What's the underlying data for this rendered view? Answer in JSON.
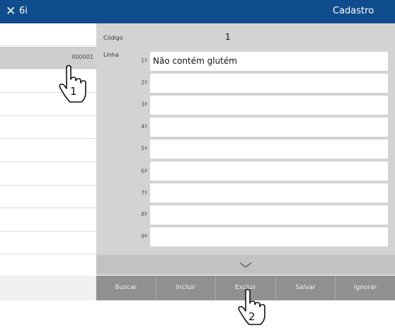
{
  "titlebar": {
    "close_icon": "close-icon",
    "app_label": "6i",
    "title": "Cadastro"
  },
  "list": {
    "rows": [
      {
        "code": ""
      },
      {
        "code": "000001"
      },
      {
        "code": ""
      },
      {
        "code": ""
      },
      {
        "code": ""
      },
      {
        "code": ""
      },
      {
        "code": ""
      },
      {
        "code": ""
      },
      {
        "code": ""
      },
      {
        "code": ""
      },
      {
        "code": ""
      },
      {
        "code": ""
      }
    ]
  },
  "form": {
    "codigo_label": "Código",
    "codigo_value": "1",
    "linha_label": "Linha",
    "lines": [
      {
        "ordinal": "1ª",
        "value": "Não contém glutém"
      },
      {
        "ordinal": "2ª",
        "value": ""
      },
      {
        "ordinal": "3ª",
        "value": ""
      },
      {
        "ordinal": "4ª",
        "value": ""
      },
      {
        "ordinal": "5ª",
        "value": ""
      },
      {
        "ordinal": "6ª",
        "value": ""
      },
      {
        "ordinal": "7ª",
        "value": ""
      },
      {
        "ordinal": "8ª",
        "value": ""
      },
      {
        "ordinal": "9ª",
        "value": ""
      }
    ]
  },
  "expander_icon": "chevron-down-icon",
  "toolbar": {
    "buttons": [
      "Buscar",
      "Incluir",
      "Excluir",
      "Salvar",
      "Ignorar"
    ]
  },
  "callouts": [
    {
      "icon": "hand-pointer-icon",
      "number": "1"
    },
    {
      "icon": "hand-pointer-icon",
      "number": "2"
    }
  ],
  "colors": {
    "titlebar": "#0f4d8c",
    "panel": "#d3d3d3",
    "toolbar": "#909090",
    "selected_row": "#cfcfcf"
  }
}
